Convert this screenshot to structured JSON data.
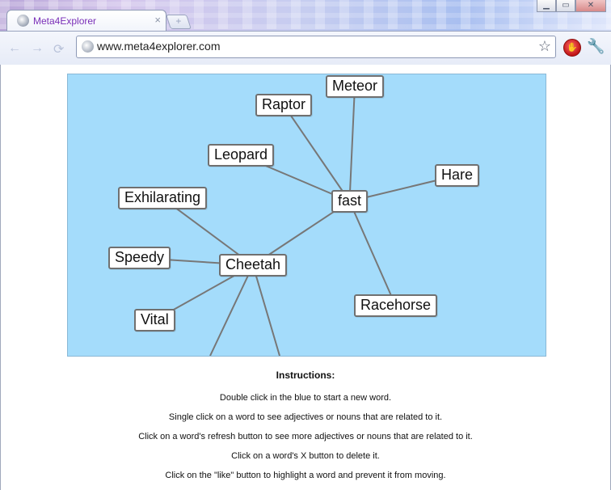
{
  "browser": {
    "tab_title": "Meta4Explorer",
    "tab_close": "×",
    "new_tab_symbol": "+",
    "url": "www.meta4explorer.com",
    "window_controls": [
      "▁",
      "▭",
      "✕"
    ],
    "nav_back": "←",
    "nav_forward": "→",
    "nav_reload": "⟳",
    "star_icon": "☆",
    "wrench_icon": "🔧",
    "stop_icon": "✋"
  },
  "map": {
    "background": "#a4dcfb",
    "link_color": "#777777",
    "words": [
      {
        "id": "meteor",
        "label": "Meteor"
      },
      {
        "id": "raptor",
        "label": "Raptor"
      },
      {
        "id": "leopard",
        "label": "Leopard"
      },
      {
        "id": "hare",
        "label": "Hare"
      },
      {
        "id": "fast",
        "label": "fast"
      },
      {
        "id": "exhilarating",
        "label": "Exhilarating"
      },
      {
        "id": "speedy",
        "label": "Speedy"
      },
      {
        "id": "cheetah",
        "label": "Cheetah"
      },
      {
        "id": "racehorse",
        "label": "Racehorse"
      },
      {
        "id": "vital",
        "label": "Vital"
      }
    ],
    "links": [
      [
        "fast",
        "meteor"
      ],
      [
        "fast",
        "raptor"
      ],
      [
        "fast",
        "leopard"
      ],
      [
        "fast",
        "hare"
      ],
      [
        "fast",
        "racehorse"
      ],
      [
        "fast",
        "cheetah"
      ],
      [
        "cheetah",
        "exhilarating"
      ],
      [
        "cheetah",
        "speedy"
      ],
      [
        "cheetah",
        "vital"
      ]
    ]
  },
  "instructions": {
    "title": "Instructions:",
    "lines": [
      "Double click in the blue to start a new word.",
      "Single click on a word to see adjectives or nouns that are related to it.",
      "Click on a word's refresh button to see more adjectives or nouns that are related to it.",
      "Click on a word's X button to delete it.",
      "Click on the \"like\" button to highlight a word and prevent it from moving."
    ]
  }
}
